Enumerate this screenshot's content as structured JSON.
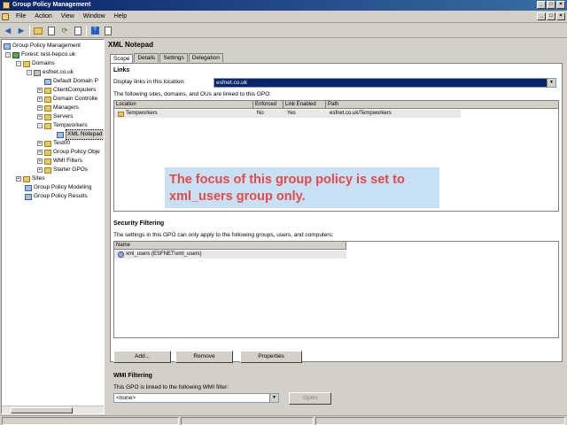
{
  "window": {
    "title": "Group Policy Management"
  },
  "menu": {
    "items": [
      "File",
      "Action",
      "View",
      "Window",
      "Help"
    ]
  },
  "tree": {
    "items": [
      {
        "label": "Group Policy Management",
        "level": 0,
        "icon": "gpm-icon"
      },
      {
        "label": "Forest: test-hepco.uk",
        "level": 1,
        "icon": "forest-icon"
      },
      {
        "label": "Domains",
        "level": 2,
        "icon": "folder-icon"
      },
      {
        "label": "esfnet.co.uk",
        "level": 3,
        "icon": "domain-icon"
      },
      {
        "label": "Default Domain P",
        "level": 4,
        "icon": "gpo-icon"
      },
      {
        "label": "ClientComputers",
        "level": 4,
        "icon": "folder-icon"
      },
      {
        "label": "Domain Controlle",
        "level": 4,
        "icon": "folder-icon"
      },
      {
        "label": "Managers",
        "level": 4,
        "icon": "folder-icon"
      },
      {
        "label": "Servers",
        "level": 4,
        "icon": "folder-icon"
      },
      {
        "label": "Tempworkers",
        "level": 4,
        "icon": "folder-icon"
      },
      {
        "label": "XML Notepad",
        "level": 5,
        "icon": "gpo-icon",
        "selected": true
      },
      {
        "label": "Test00",
        "level": 4,
        "icon": "folder-icon"
      },
      {
        "label": "Group Policy Obje",
        "level": 4,
        "icon": "folder-icon"
      },
      {
        "label": "WMI Filters",
        "level": 4,
        "icon": "folder-icon"
      },
      {
        "label": "Starter GPOs",
        "level": 4,
        "icon": "folder-icon"
      },
      {
        "label": "Sites",
        "level": 1,
        "icon": "folder-icon"
      },
      {
        "label": "Group Policy Modeling",
        "level": 1,
        "icon": "gpo-icon"
      },
      {
        "label": "Group Policy Results",
        "level": 1,
        "icon": "gpo-icon"
      }
    ]
  },
  "gpo": {
    "title": "XML Notepad",
    "tabs": [
      "Scope",
      "Details",
      "Settings",
      "Delegation"
    ],
    "links": {
      "heading": "Links",
      "display_label": "Display links in this location:",
      "location_value": "esfnet.co.uk",
      "description": "The following sites, domains, and OUs are linked to this GPO:",
      "columns": [
        "Location",
        "Enforced",
        "Link Enabled",
        "Path"
      ],
      "rows": [
        {
          "location": "Tempworkers",
          "enforced": "No",
          "link_enabled": "Yes",
          "path": "esfnet.co.uk/Tempworkers"
        }
      ]
    },
    "security": {
      "heading": "Security Filtering",
      "description": "The settings in this GPO can only apply to the following groups, users, and computers:",
      "columns": [
        "Name"
      ],
      "rows": [
        {
          "name": "xml_users (ESFNET\\xml_users)"
        }
      ],
      "buttons": {
        "add": "Add...",
        "remove": "Remove",
        "properties": "Properties"
      }
    },
    "wmi": {
      "heading": "WMI Filtering",
      "description": "This GPO is linked to the following WMI filter:",
      "filter_value": "<none>",
      "open_label": "Open"
    }
  },
  "annotation": {
    "text": "The focus of  this group policy is set to xml_users group only."
  }
}
